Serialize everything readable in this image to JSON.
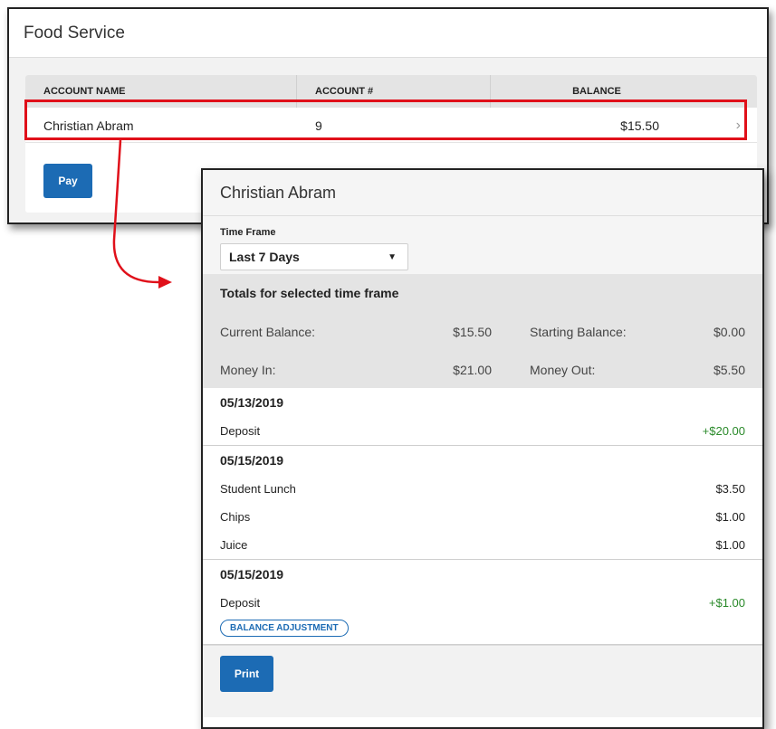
{
  "app": {
    "title": "Food Service"
  },
  "accounts": {
    "columns": {
      "name": "ACCOUNT NAME",
      "number": "ACCOUNT #",
      "balance": "BALANCE"
    },
    "rows": [
      {
        "name": "Christian Abram",
        "number": "9",
        "balance": "$15.50"
      }
    ],
    "pay_label": "Pay"
  },
  "detail": {
    "title": "Christian Abram",
    "time_frame": {
      "label": "Time Frame",
      "value": "Last 7 Days"
    },
    "totals": {
      "heading": "Totals for selected time frame",
      "current_balance_label": "Current Balance:",
      "current_balance": "$15.50",
      "starting_balance_label": "Starting Balance:",
      "starting_balance": "$0.00",
      "money_in_label": "Money In:",
      "money_in": "$21.00",
      "money_out_label": "Money Out:",
      "money_out": "$5.50"
    },
    "groups": [
      {
        "date": "05/13/2019",
        "items": [
          {
            "label": "Deposit",
            "amount": "+$20.00"
          }
        ]
      },
      {
        "date": "05/15/2019",
        "items": [
          {
            "label": "Student Lunch",
            "amount": "$3.50"
          },
          {
            "label": "Chips",
            "amount": "$1.00"
          },
          {
            "label": "Juice",
            "amount": "$1.00"
          }
        ]
      },
      {
        "date": "05/15/2019",
        "items": [
          {
            "label": "Deposit",
            "amount": "+$1.00"
          }
        ],
        "badge": "BALANCE ADJUSTMENT"
      }
    ],
    "print_label": "Print"
  },
  "colors": {
    "accent": "#1c6bb4",
    "highlight": "#e0101a",
    "positive": "#2a8a2a"
  }
}
